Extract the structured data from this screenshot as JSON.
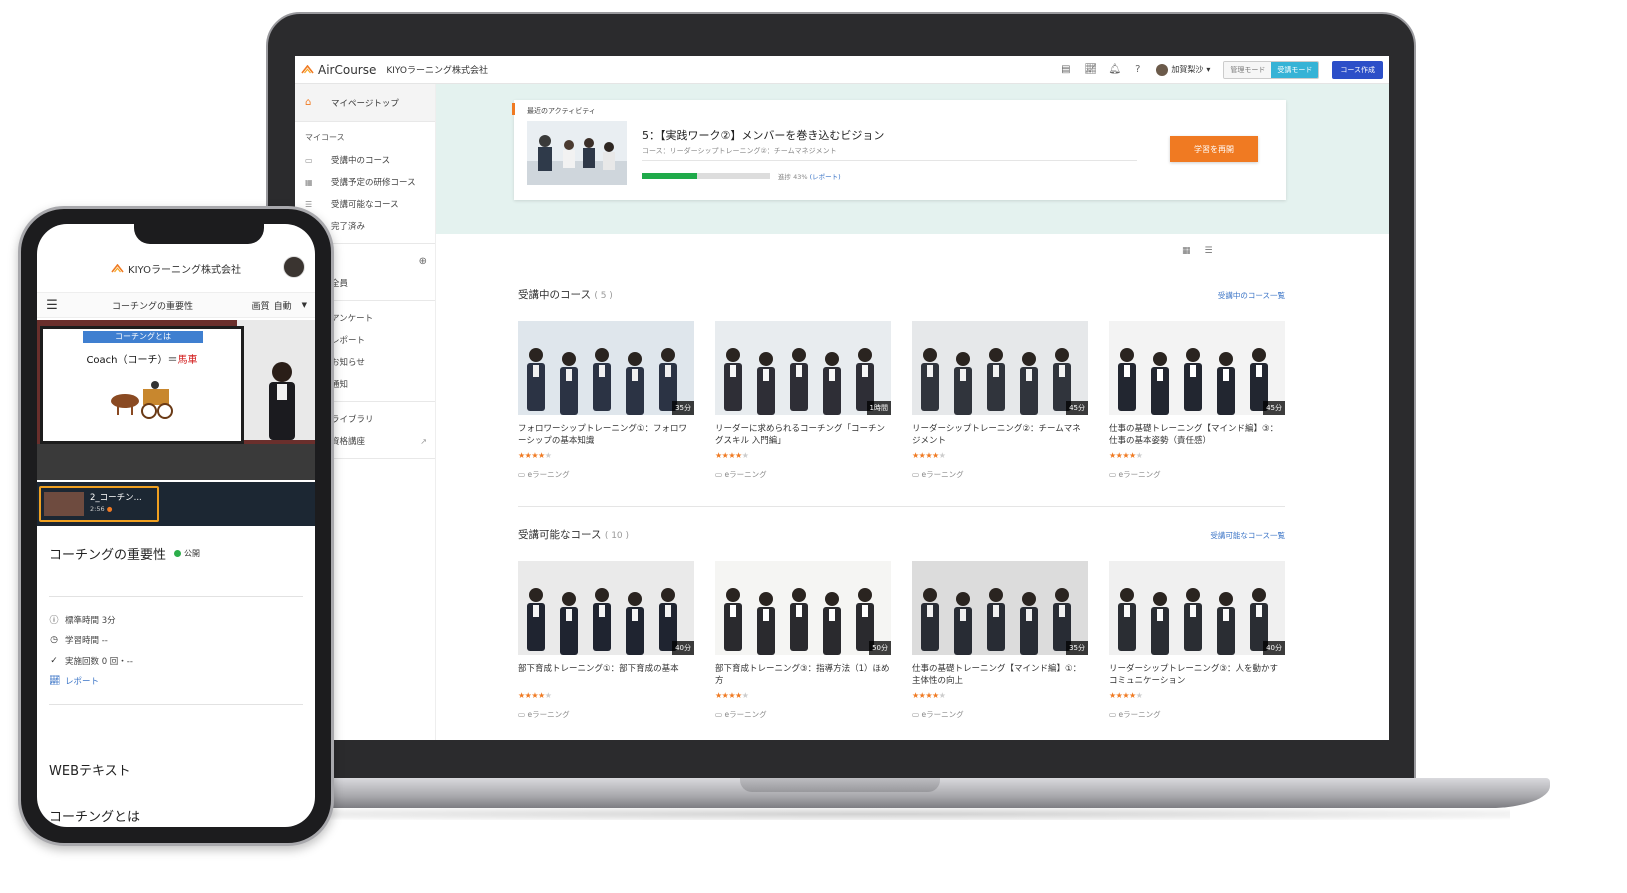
{
  "colors": {
    "accent": "#f07a22",
    "link": "#3973c6",
    "primary": "#2c4fc8",
    "mode_active": "#36b3d6",
    "progress": "#1faa4a",
    "band": "#e4f2ef"
  },
  "desktop": {
    "header": {
      "brand": "AirCourse",
      "company": "KIYOラーニング株式会社",
      "icons": [
        "document-icon",
        "chart-icon",
        "bell-icon",
        "help-icon"
      ],
      "user_name": "加賀梨沙",
      "mode_admin": "管理モード",
      "mode_learner": "受講モード",
      "create_course": "コース作成"
    },
    "sidebar": {
      "top": "マイページトップ",
      "section_my": "マイコース",
      "my_items": [
        "受講中のコース",
        "受講予定の研修コース",
        "受講可能なコース",
        "完了済み"
      ],
      "group_item": "全員",
      "misc_items": [
        "アンケート",
        "レポート",
        "お知らせ",
        "通知"
      ],
      "library_items": [
        "ライブラリ",
        "資格講座"
      ]
    },
    "activity": {
      "label": "最近のアクティビティ",
      "title": "5：【実践ワーク②】メンバーを巻き込むビジョン",
      "course": "コース：リーダーシップトレーニング②：チームマネジメント",
      "progress": 43,
      "progress_text": "進捗 43%",
      "report_link": "(レポート)",
      "resume": "学習を再開"
    },
    "in_progress": {
      "title": "受講中のコース",
      "count": "( 5 )",
      "link": "受講中のコース一覧",
      "courses": [
        {
          "title": "フォロワーシップトレーニング①：フォロワーシップの基本知識",
          "duration": "35分",
          "rating": 4,
          "type": "eラーニング"
        },
        {
          "title": "リーダーに求められるコーチング「コーチングスキル 入門編」",
          "duration": "1時間",
          "rating": 4,
          "type": "eラーニング"
        },
        {
          "title": "リーダーシップトレーニング②：チームマネジメント",
          "duration": "45分",
          "rating": 4,
          "type": "eラーニング"
        },
        {
          "title": "仕事の基礎トレーニング【マインド編】③：仕事の基本姿勢（責任感）",
          "duration": "45分",
          "rating": 4,
          "type": "eラーニング"
        }
      ]
    },
    "available": {
      "title": "受講可能なコース",
      "count": "( 10 )",
      "link": "受講可能なコース一覧",
      "courses": [
        {
          "title": "部下育成トレーニング①：部下育成の基本",
          "duration": "40分",
          "rating": 4,
          "type": "eラーニング"
        },
        {
          "title": "部下育成トレーニング③：指導方法（1）ほめ方",
          "duration": "50分",
          "rating": 4,
          "type": "eラーニング"
        },
        {
          "title": "仕事の基礎トレーニング【マインド編】①：主体性の向上",
          "duration": "35分",
          "rating": 4,
          "type": "eラーニング"
        },
        {
          "title": "リーダーシップトレーニング③：人を動かすコミュニケーション",
          "duration": "40分",
          "rating": 4,
          "type": "eラーニング"
        }
      ]
    }
  },
  "mobile": {
    "company": "KIYOラーニング株式会社",
    "lesson_name": "コーチングの重要性",
    "quality_label": "画質",
    "quality_value": "自動",
    "slide_title": "コーチングとは",
    "slide_line_a": "Coach（コーチ）＝",
    "slide_line_b": "馬車",
    "playlist_title": "2_コーチン...",
    "playlist_time": "2:56",
    "title": "コーチングの重要性",
    "status": "公開",
    "std_time": "標準時間 3分",
    "study_time": "学習時間 --",
    "runs": "実施回数 0 回・--",
    "report": "レポート",
    "web_text": "WEBテキスト",
    "section_heading": "コーチングとは"
  }
}
